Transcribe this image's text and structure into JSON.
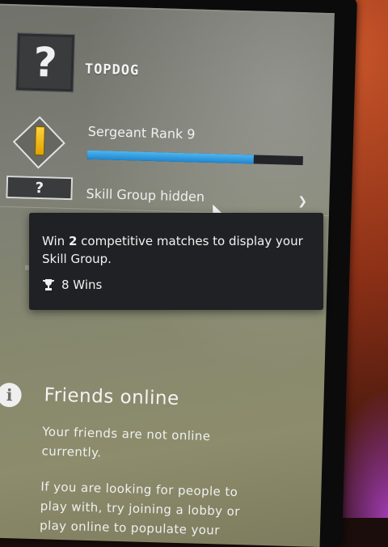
{
  "profile": {
    "username": "TOPDOG",
    "avatar_glyph": "?"
  },
  "rank": {
    "name": "Sergeant Rank 9",
    "xp_progress": 0.77,
    "accent": "#2f9be0"
  },
  "skill_group": {
    "icon_glyph": "?",
    "label": "Skill Group hidden"
  },
  "tooltip": {
    "text_before": "Win ",
    "count": "2",
    "text_after": " competitive matches to display your Skill Group.",
    "wins_label": "8 Wins"
  },
  "friends": {
    "title": "Friends online",
    "message1": "Your friends are not online currently.",
    "message2": "If you are looking for people to play with, try joining a lobby or play online to populate your"
  },
  "icons": {
    "expand": "chevron-down-icon",
    "trophy": "trophy-icon",
    "info": "info-icon"
  }
}
